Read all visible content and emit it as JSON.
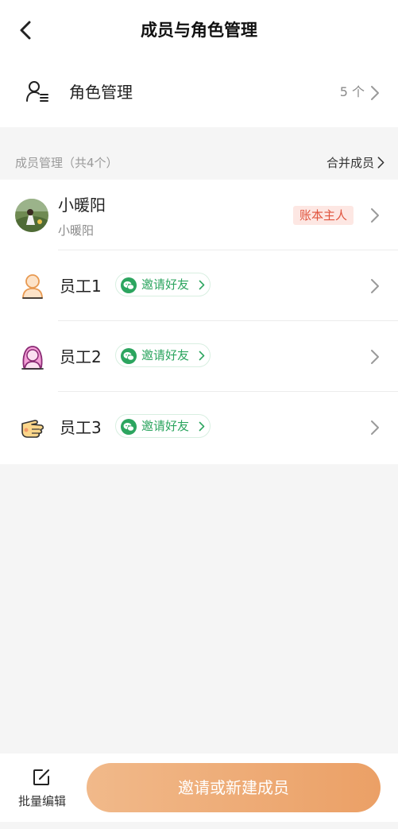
{
  "header": {
    "title": "成员与角色管理"
  },
  "roles": {
    "label": "角色管理",
    "count": "5 个"
  },
  "members_section": {
    "title": "成员管理（共4个）",
    "merge_label": "合并成员"
  },
  "members": [
    {
      "name": "小暖阳",
      "subname": "小暖阳",
      "badge": "账本主人"
    },
    {
      "name": "员工1",
      "invite": "邀请好友"
    },
    {
      "name": "员工2",
      "invite": "邀请好友"
    },
    {
      "name": "员工3",
      "invite": "邀请好友"
    }
  ],
  "footer": {
    "batch_edit_label": "批量编辑",
    "primary_button_label": "邀请或新建成员"
  },
  "colors": {
    "accent": "#eba066",
    "invite_green": "#2ca55f",
    "owner_badge_text": "#e0533d",
    "owner_badge_bg": "#fde7e3"
  }
}
